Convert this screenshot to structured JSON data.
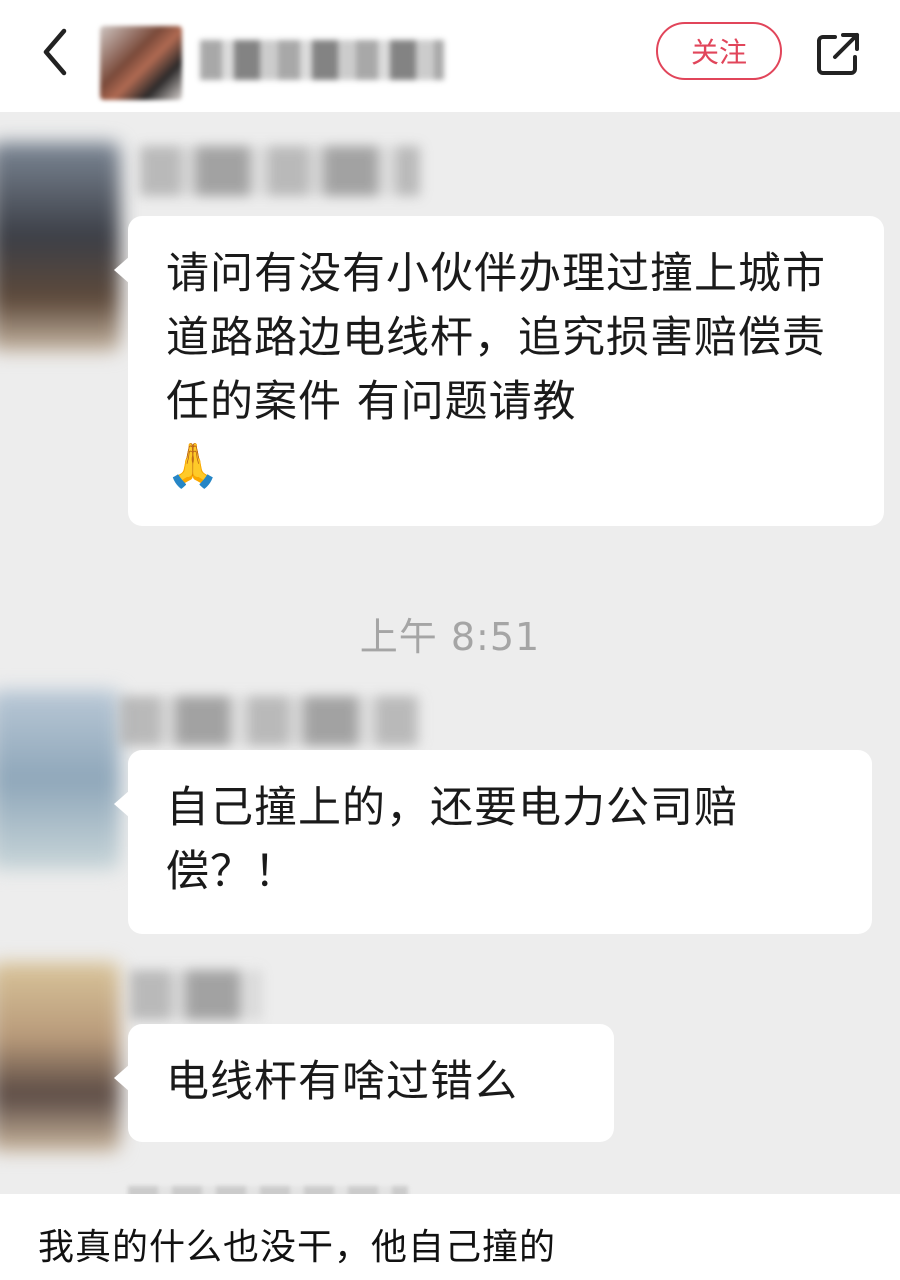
{
  "header": {
    "back_icon": "chevron-left-icon",
    "follow_label": "关注",
    "share_icon": "share-external-icon",
    "accent_color": "#e1455a"
  },
  "messages": [
    {
      "text": "请问有没有小伙伴办理过撞上城市道路路边电线杆，追究损害赔偿责任的案件 有问题请教",
      "emoji": "🙏"
    },
    {
      "text": "自己撞上的，还要电力公司赔偿？！"
    },
    {
      "text": "电线杆有啥过错么"
    }
  ],
  "timestamp": "上午 8:51",
  "caption": "我真的什么也没干，他自己撞的"
}
